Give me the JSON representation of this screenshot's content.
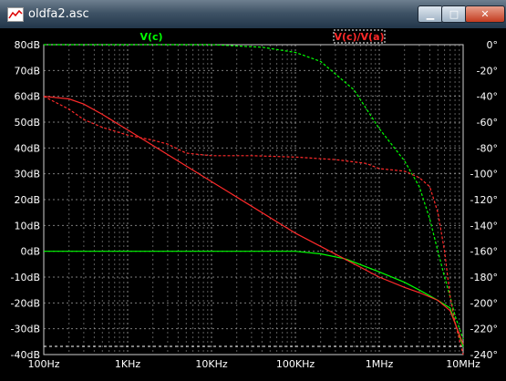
{
  "window": {
    "title": "oldfa2.asc",
    "min_glyph": "▁",
    "max_glyph": "□",
    "close_glyph": "✕"
  },
  "traces": [
    {
      "label": "V(c)",
      "color": "#00ff00"
    },
    {
      "label": "V(c)/V(a)",
      "color": "#ff0000"
    }
  ],
  "axes": {
    "left_ticks": [
      "80dB",
      "70dB",
      "60dB",
      "50dB",
      "40dB",
      "30dB",
      "20dB",
      "10dB",
      "0dB",
      "-10dB",
      "-20dB",
      "-30dB",
      "-40dB"
    ],
    "right_ticks": [
      "0°",
      "-20°",
      "-40°",
      "-60°",
      "-80°",
      "-100°",
      "-120°",
      "-140°",
      "-160°",
      "-180°",
      "-200°",
      "-220°",
      "-240°"
    ],
    "x_ticks": [
      "100Hz",
      "1KHz",
      "10KHz",
      "100KHz",
      "1MHz",
      "10MHz"
    ]
  },
  "colors": {
    "grid": "#9a9a9a",
    "text": "#ffffff",
    "green": "#00ff00",
    "red": "#ff2a2a"
  },
  "chart_data": {
    "type": "line",
    "x_scale": "log",
    "xlim": [
      100,
      10000000
    ],
    "ylim": [
      -40,
      80
    ],
    "ylim_right": [
      -240,
      0
    ],
    "series": [
      {
        "name": "V(c)",
        "quantity": "magnitude",
        "x": [
          100,
          1000,
          10000,
          100000,
          200000,
          400000,
          1000000,
          2000000,
          3000000,
          5000000,
          7000000,
          10000000
        ],
        "y": [
          0,
          0,
          0,
          0,
          -1,
          -3,
          -8,
          -12,
          -15,
          -19,
          -22,
          -37
        ]
      },
      {
        "name": "V(c)",
        "quantity": "phase",
        "x": [
          100,
          10000,
          40000,
          100000,
          200000,
          500000,
          1000000,
          2000000,
          3000000,
          4000000,
          5000000,
          6000000,
          7000000,
          8000000,
          10000000
        ],
        "y": [
          0,
          0,
          -2,
          -6,
          -13,
          -35,
          -65,
          -90,
          -110,
          -135,
          -160,
          -180,
          -195,
          -210,
          -228
        ]
      },
      {
        "name": "V(c)/V(a)",
        "quantity": "magnitude",
        "x": [
          100,
          200,
          300,
          500,
          1000,
          10000,
          100000,
          1000000,
          2000000,
          3000000,
          5000000,
          7000000,
          10000000
        ],
        "y": [
          60,
          59,
          57,
          53,
          47,
          27,
          7,
          -10,
          -14,
          -16,
          -19,
          -23,
          -36
        ]
      },
      {
        "name": "V(c)/V(a)",
        "quantity": "phase",
        "x": [
          100,
          200,
          300,
          500,
          1000,
          2000,
          3000,
          5000,
          10000,
          30000,
          100000,
          300000,
          700000,
          1000000,
          2000000,
          3000000,
          4000000,
          5000000,
          6000000,
          7000000,
          8000000,
          10000000
        ],
        "y": [
          -40,
          -50,
          -58,
          -64,
          -70,
          -74,
          -77,
          -84,
          -86,
          -86,
          -87,
          -89,
          -92,
          -96,
          -98,
          -103,
          -110,
          -130,
          -160,
          -195,
          -215,
          -240
        ]
      }
    ]
  }
}
